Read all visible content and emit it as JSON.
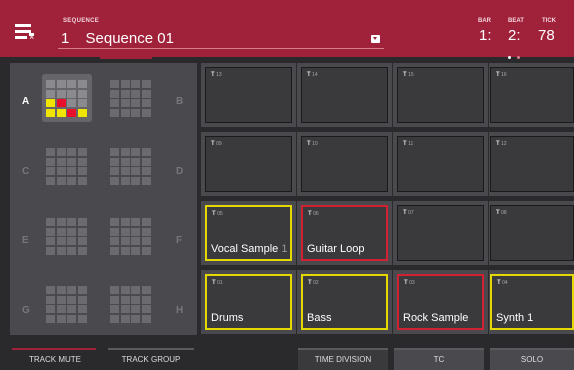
{
  "header": {
    "sequence_label": "SEQUENCE",
    "sequence_number": "1",
    "sequence_name": "Sequence 01",
    "bar_label": "BAR",
    "bar_value": "1:",
    "beat_label": "BEAT",
    "beat_value": "2:",
    "tick_label": "TICK",
    "tick_value": "78"
  },
  "banks": [
    {
      "letter": "A",
      "active": true
    },
    {
      "letter": "B",
      "active": false
    },
    {
      "letter": "C",
      "active": false
    },
    {
      "letter": "D",
      "active": false
    },
    {
      "letter": "E",
      "active": false
    },
    {
      "letter": "F",
      "active": false
    },
    {
      "letter": "G",
      "active": false
    },
    {
      "letter": "H",
      "active": false
    }
  ],
  "pads": [
    {
      "t": "13",
      "name": "",
      "sub": "",
      "state": "normal"
    },
    {
      "t": "14",
      "name": "",
      "sub": "",
      "state": "normal"
    },
    {
      "t": "15",
      "name": "",
      "sub": "",
      "state": "normal"
    },
    {
      "t": "16",
      "name": "",
      "sub": "",
      "state": "normal"
    },
    {
      "t": "09",
      "name": "",
      "sub": "",
      "state": "normal"
    },
    {
      "t": "10",
      "name": "",
      "sub": "",
      "state": "normal"
    },
    {
      "t": "11",
      "name": "",
      "sub": "",
      "state": "normal"
    },
    {
      "t": "12",
      "name": "",
      "sub": "",
      "state": "normal"
    },
    {
      "t": "05",
      "name": "Vocal Sample",
      "sub": "1",
      "state": "yellow"
    },
    {
      "t": "06",
      "name": "Guitar Loop",
      "sub": "",
      "state": "red"
    },
    {
      "t": "07",
      "name": "",
      "sub": "",
      "state": "normal"
    },
    {
      "t": "08",
      "name": "",
      "sub": "",
      "state": "normal"
    },
    {
      "t": "01",
      "name": "Drums",
      "sub": "",
      "state": "yellow"
    },
    {
      "t": "02",
      "name": "Bass",
      "sub": "",
      "state": "yellow"
    },
    {
      "t": "03",
      "name": "Rock Sample",
      "sub": "",
      "state": "red"
    },
    {
      "t": "04",
      "name": "Synth 1",
      "sub": "",
      "state": "yellow"
    }
  ],
  "bottom": {
    "track_mute": "TRACK MUTE",
    "track_group": "TRACK GROUP",
    "time_division": "TIME DIVISION",
    "tc": "TC",
    "solo": "SOLO"
  },
  "colors": {
    "accent": "#a0213a",
    "yellow": "#e3d900",
    "red": "#d02233"
  }
}
